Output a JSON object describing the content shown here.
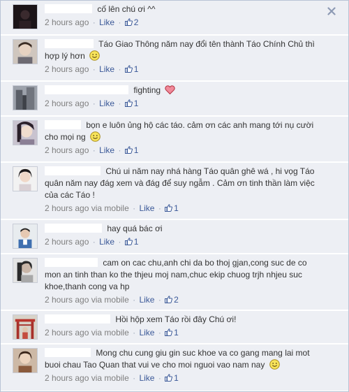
{
  "comments": [
    {
      "text": "cố lên chú ơi ^^",
      "time": "2 hours ago",
      "via": "",
      "like_label": "Like",
      "likes": "2",
      "emoji": ""
    },
    {
      "text": "Táo Giao Thông năm nay đổi tên thành Táo Chính Chủ thì hợp lý hơn",
      "time": "2 hours ago",
      "via": "",
      "like_label": "Like",
      "likes": "1",
      "emoji": "smile"
    },
    {
      "text": "fighting",
      "time": "2 hours ago",
      "via": "",
      "like_label": "Like",
      "likes": "1",
      "emoji": "heart"
    },
    {
      "text": "bọn e luôn ủng hộ các táo. cảm ơn các anh mang tới nụ cười cho mọi ng",
      "time": "2 hours ago",
      "via": "",
      "like_label": "Like",
      "likes": "1",
      "emoji": "smile"
    },
    {
      "text": "Chú ui năm nay nhá hàng Táo quân ghê wá , hi vọg Táo quân năm nay đág xem và đág để suy ngẫm . Cảm ơn tinh thần làm việc của các Táo !",
      "time": "2 hours ago",
      "via": "via mobile",
      "like_label": "Like",
      "likes": "1",
      "emoji": ""
    },
    {
      "text": "hay quá bác ơi",
      "time": "2 hours ago",
      "via": "",
      "like_label": "Like",
      "likes": "1",
      "emoji": ""
    },
    {
      "text": "cam on cac chu,anh chi da bo thoj gjan,cong suc de co mon an tinh than ko the thjeu moj nam,chuc ekip chuog trjh nhjeu suc khoe,thanh cong va hp",
      "time": "2 hours ago",
      "via": "via mobile",
      "like_label": "Like",
      "likes": "2",
      "emoji": ""
    },
    {
      "text": "Hồi hộp xem Táo rồi đây Chú ơi!",
      "time": "2 hours ago",
      "via": "via mobile",
      "like_label": "Like",
      "likes": "1",
      "emoji": ""
    },
    {
      "text": "Mong chu cung giu gin suc khoe va co gang mang lai mot buoi chau Tao Quan that vui ve cho moi nguoi vao nam nay",
      "time": "2 hours ago",
      "via": "via mobile",
      "like_label": "Like",
      "likes": "1",
      "emoji": "smile"
    }
  ],
  "separator": "·",
  "icons": {
    "close": "close-icon",
    "like_count": "thumbs-up-icon",
    "smile": "smiley-icon",
    "heart": "heart-icon"
  },
  "colors": {
    "link": "#3b5998",
    "meta": "#7f7f7f",
    "row_bg": "#edeff4"
  }
}
